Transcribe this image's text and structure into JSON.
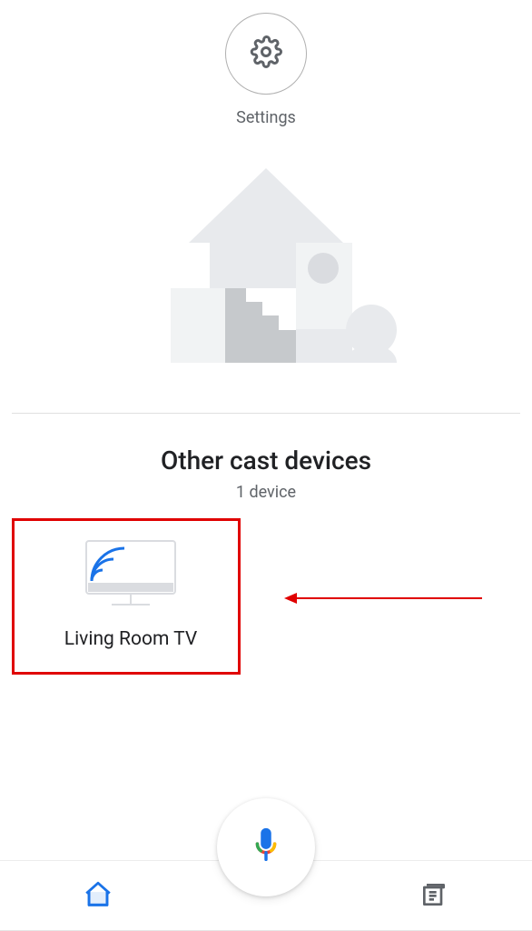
{
  "settings": {
    "label": "Settings"
  },
  "section": {
    "title": "Other cast devices",
    "subtitle": "1 device"
  },
  "devices": [
    {
      "name": "Living Room TV"
    }
  ],
  "colors": {
    "accent": "#1a73e8",
    "muted": "#5f6368"
  }
}
